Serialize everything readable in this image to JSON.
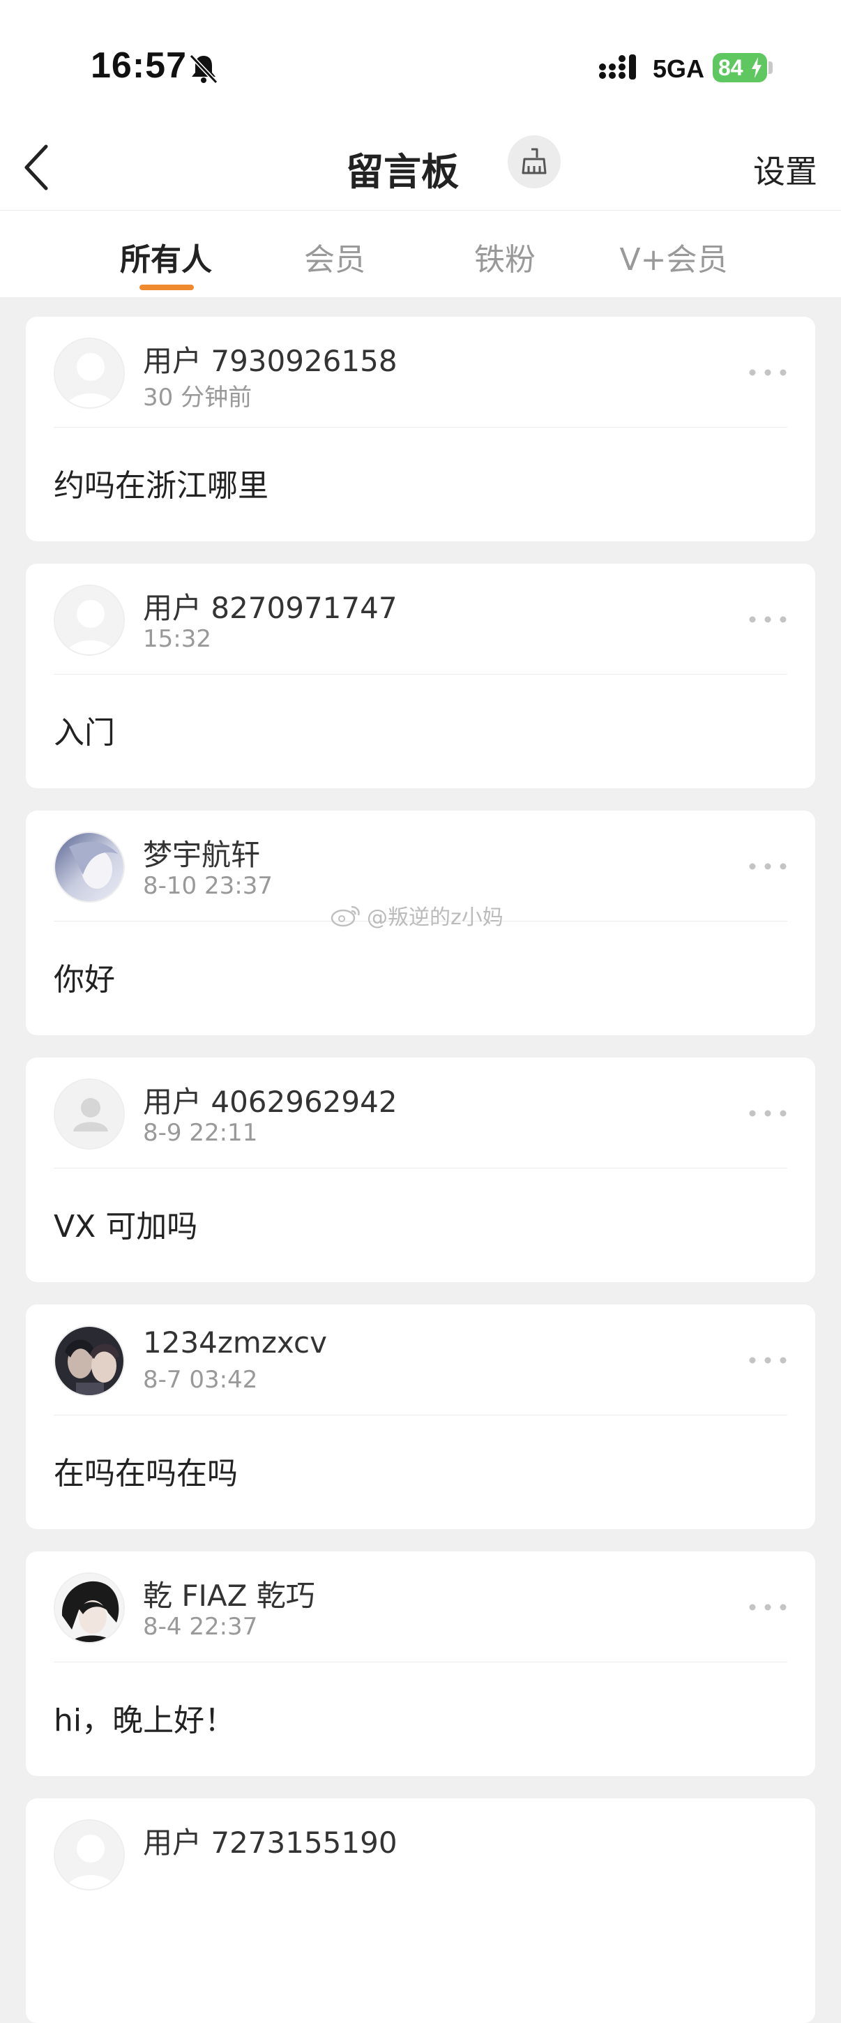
{
  "status_bar": {
    "time": "16:57",
    "network": "5GA",
    "battery": "84"
  },
  "nav": {
    "title": "留言板",
    "settings": "设置"
  },
  "tabs": [
    {
      "label": "所有人",
      "active": true
    },
    {
      "label": "会员",
      "active": false
    },
    {
      "label": "铁粉",
      "active": false
    },
    {
      "label": "V+会员",
      "active": false
    }
  ],
  "messages": [
    {
      "user": "用户 7930926158",
      "time": "30 分钟前",
      "text": "约吗在浙江哪里",
      "avatar": "default-avatar"
    },
    {
      "user": "用户 8270971747",
      "time": "15:32",
      "text": "入门",
      "avatar": "default-avatar"
    },
    {
      "user": "梦宇航轩",
      "time": "8-10 23:37",
      "text": "你好",
      "avatar": "photo-avatar"
    },
    {
      "user": "用户 4062962942",
      "time": "8-9 22:11",
      "text": "VX 可加吗",
      "avatar": "default-person-avatar"
    },
    {
      "user": "1234zmzxcv",
      "time": "8-7 03:42",
      "text": "在吗在吗在吗",
      "avatar": "photo-avatar"
    },
    {
      "user": "乾 FIAZ 乾巧",
      "time": "8-4 22:37",
      "text": "hi，晚上好！",
      "avatar": "photo-avatar"
    },
    {
      "user": "用户 7273155190",
      "time": "",
      "text": "",
      "avatar": "default-avatar"
    }
  ],
  "watermark": "@叛逆的z小妈",
  "colors": {
    "accent": "#f08a2e",
    "battery": "#5fc760",
    "background": "#f0f0f0"
  }
}
